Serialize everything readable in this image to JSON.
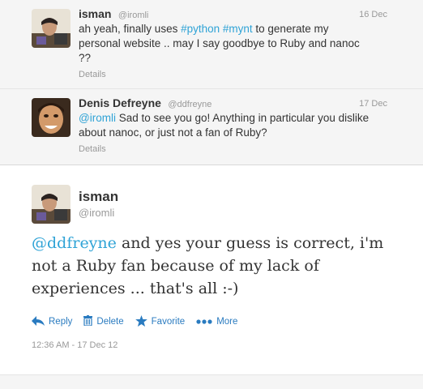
{
  "context_tweets": [
    {
      "fullname": "isman",
      "screen_name": "@iromli",
      "date": "16 Dec",
      "text_before": "ah yeah, finally uses ",
      "hashtag_1": "#python",
      "text_between": " ",
      "hashtag_2": "#mynt",
      "text_after": " to generate my personal website .. may I say goodbye to Ruby and nanoc ??",
      "details_label": "Details"
    },
    {
      "fullname": "Denis Defreyne",
      "screen_name": "@ddfreyne",
      "date": "17 Dec",
      "mention": "@iromli",
      "text_after": " Sad to see you go! Anything in particular you dislike about nanoc, or just not a fan of Ruby?",
      "details_label": "Details"
    }
  ],
  "main_tweet": {
    "fullname": "isman",
    "screen_name": "@iromli",
    "mention": "@ddfreyne",
    "text_after": " and yes your guess is correct, i'm not a Ruby fan because of my lack of experiences ... that's all :-)",
    "timestamp": "12:36 AM - 17 Dec 12",
    "actions": {
      "reply": "Reply",
      "delete": "Delete",
      "favorite": "Favorite",
      "more": "More"
    }
  },
  "colors": {
    "link": "#2fa3d6",
    "action": "#2a7bc0",
    "muted": "#999999",
    "context_bg": "#f5f5f5"
  },
  "icons": [
    "reply-icon",
    "trash-icon",
    "star-icon",
    "more-dots-icon"
  ]
}
